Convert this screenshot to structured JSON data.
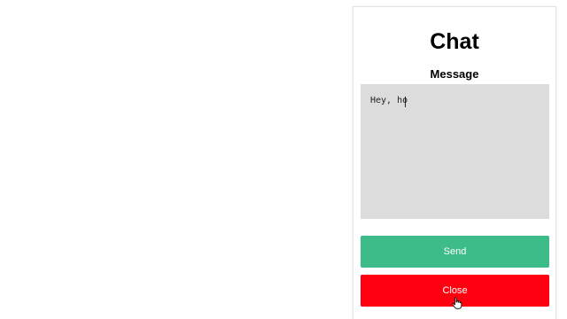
{
  "chat": {
    "title": "Chat",
    "message_label": "Message",
    "message_value": "Hey, ho",
    "send_label": "Send",
    "close_label": "Close"
  },
  "icons": {
    "cursor": "hand-pointer-icon"
  },
  "colors": {
    "send_button": "#3dbb89",
    "close_button": "#ff0011",
    "input_background": "#dcdcdc"
  }
}
